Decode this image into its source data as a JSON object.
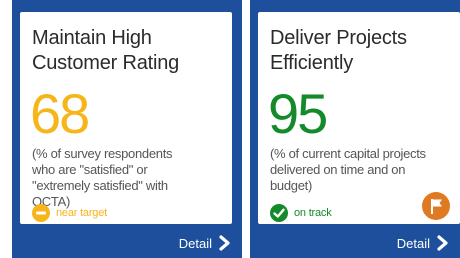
{
  "cards": [
    {
      "title_line1": "Maintain High",
      "title_line2": "Customer Rating",
      "value": "68",
      "description_lines": [
        "(% of survey respondents",
        "who are \"satisfied\" or",
        "\"extremely satisfied\" with",
        "OCTA)"
      ],
      "status_label": "near target",
      "status_color": "#f6b51b",
      "status_icon": "minus-circle-icon",
      "detail_label": "Detail"
    },
    {
      "title_line1": "Deliver Projects",
      "title_line2": "Efficiently",
      "value": "95",
      "description_lines": [
        "(% of current capital projects",
        "delivered on time and on",
        "budget)"
      ],
      "status_label": "on track",
      "status_color": "#148a2b",
      "status_icon": "check-circle-icon",
      "badge_icon": "flag-icon",
      "badge_color": "#e07a22",
      "detail_label": "Detail"
    }
  ],
  "colors": {
    "card_frame": "#1e4f9d",
    "near_target": "#f6b51b",
    "on_track": "#148a2b"
  }
}
